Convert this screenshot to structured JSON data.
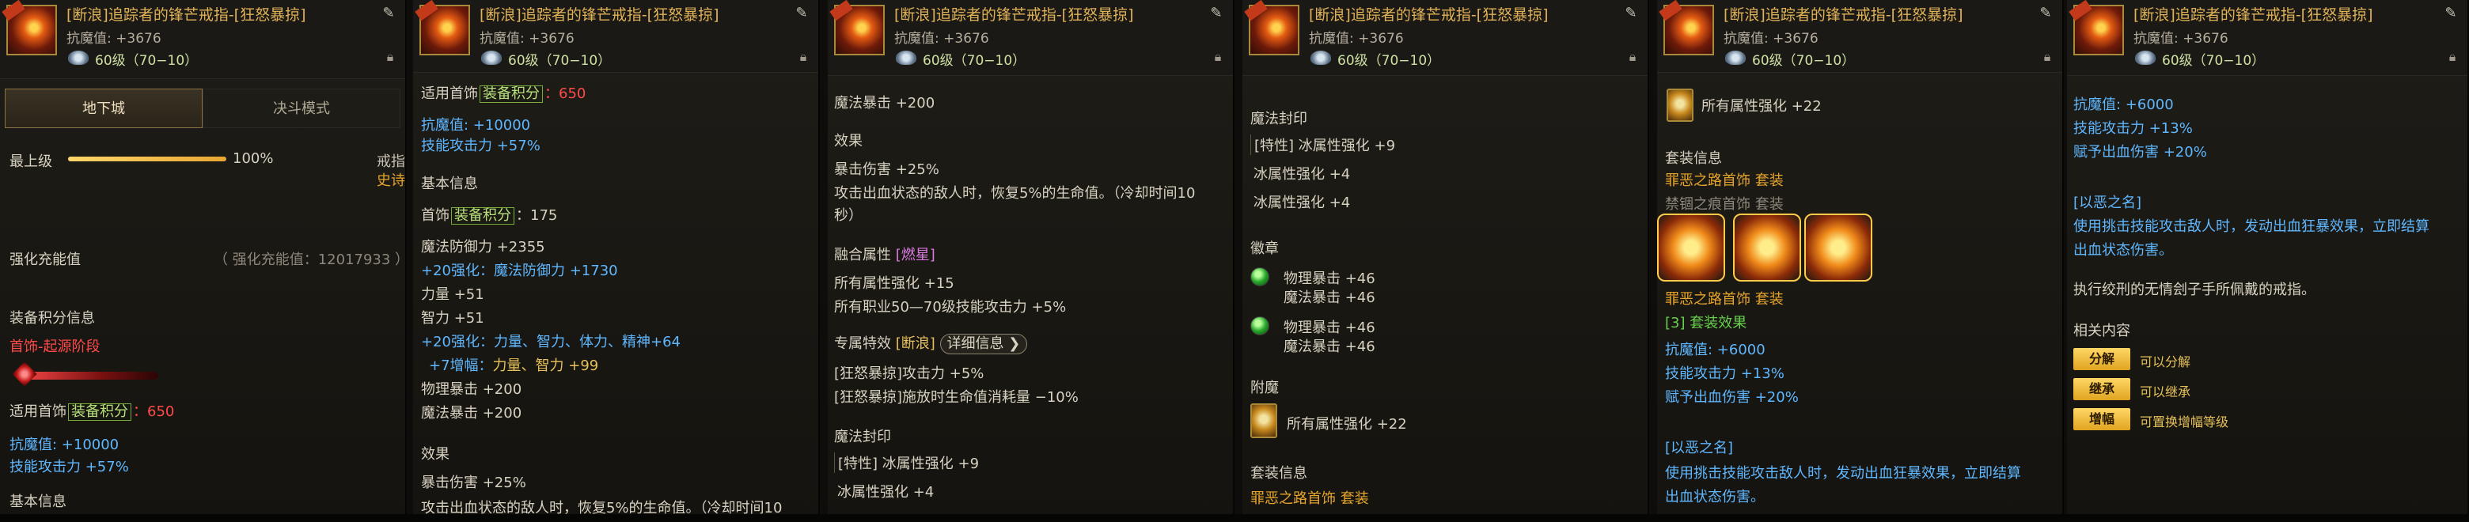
{
  "item": {
    "title": "[断浪]追踪者的锋芒戒指-[狂怒暴掠]",
    "resist": "抗魔值: +3676",
    "level": "60级（70−10）"
  },
  "p1": {
    "tab_dungeon": "地下城",
    "tab_duel": "决斗模式",
    "top_level": "最上级",
    "percent": "100%",
    "progress": 1.0,
    "type": "戒指",
    "rarity": "史诗",
    "reinforce_label": "强化充能值",
    "reinforce_value": "（ 强化充能值：12017933 ）",
    "score_info": "装备积分信息",
    "stage": "首饰-起源阶段",
    "apply_prefix": "适用首饰",
    "apply_kw": "装备积分",
    "apply_suffix": "：650",
    "resist_bonus": "抗魔值: +10000",
    "skill_bonus": "技能攻击力 +57%",
    "basic": "基本信息"
  },
  "p2": {
    "apply_prefix": "适用首饰",
    "apply_kw": "装备积分",
    "apply_val": "：650",
    "resist_bonus": "抗魔值: +10000",
    "skill_bonus": "技能攻击力 +57%",
    "basic": "基本信息",
    "acc_prefix": "首饰",
    "acc_kw": "装备积分",
    "acc_val": "：175",
    "mdef": "魔法防御力 +2355",
    "reinforce_prefix": "+20强化：",
    "reinforce_val": "魔法防御力 +1730",
    "str": "力量 +51",
    "int": "智力 +51",
    "r20_prefix": "+20强化：",
    "r20_val": "力量、智力、体力、精神+64",
    "amp_prefix": "+7增幅：",
    "amp_val": "力量、智力 +99",
    "phys_crit": "物理暴击 +200",
    "mag_crit": "魔法暴击 +200",
    "effect": "效果",
    "crit_dmg": "暴击伤害 +25%",
    "cut_line": "攻击出血状态的敌人时，恢复5%的生命值。（冷却时间10"
  },
  "p3": {
    "mag_crit": "魔法暴击 +200",
    "effect": "效果",
    "crit_dmg": "暴击伤害 +25%",
    "heal1": "攻击出血状态的敌人时，恢复5%的生命值。（冷却时间10",
    "heal2": "秒）",
    "fusion_prefix": "融合属性",
    "fusion_tag": "[燃星]",
    "all_elem": "所有属性强化 +15",
    "all_job": "所有职业50—70级技能攻击力 +5%",
    "special_prefix": "专属特效",
    "special_tag": "[断浪]",
    "detail": "详细信息",
    "special1": "[狂怒暴掠]攻击力 +5%",
    "special2": "[狂怒暴掠]施放时生命值消耗量 −10%",
    "seal": "魔法封印",
    "seal_trait": "[特性] 冰属性强化 +9",
    "seal_ice": "冰属性强化 +4"
  },
  "p4": {
    "seal": "魔法封印",
    "seal_trait": "[特性] 冰属性强化 +9",
    "ice1": "冰属性强化 +4",
    "ice2": "冰属性强化 +4",
    "emblem": "徽章",
    "em1a": "物理暴击 +46",
    "em1b": "魔法暴击 +46",
    "em2a": "物理暴击 +46",
    "em2b": "魔法暴击 +46",
    "enchant": "附魔",
    "enchant_val": "所有属性强化 +22",
    "set_info": "套装信息",
    "set_line_prefix": "罪恶之路首饰",
    "set_line_suffix": "套装"
  },
  "p5": {
    "enchant_val": "所有属性强化 +22",
    "set_info": "套装信息",
    "set1_prefix": "罪恶之路首饰",
    "set1_suffix": "套装",
    "set2_prefix": "禁锢之痕首饰",
    "set2_suffix": "套装",
    "set3_prefix": "罪恶之路首饰",
    "set3_suffix": "套装",
    "set_effect": "[3] 套装效果",
    "resist": "抗魔值: +6000",
    "skill": "技能攻击力 +13%",
    "bleed": "赋予出血伤害 +20%",
    "evil_name": "[以恶之名]",
    "evil1": "使用挑击技能攻击敌人时，发动出血狂暴效果，立即结算",
    "evil2": "出血状态伤害。"
  },
  "p6": {
    "set_effect_cut": "[3] 套装效果",
    "resist": "抗魔值: +6000",
    "skill": "技能攻击力 +13%",
    "bleed": "赋予出血伤害 +20%",
    "evil_name": "[以恶之名]",
    "evil1": "使用挑击技能攻击敌人时，发动出血狂暴效果，立即结算",
    "evil2": "出血状态伤害。",
    "flavor": "执行绞刑的无情刽子手所佩戴的戒指。",
    "related": "相关内容",
    "btn_split": "分解",
    "split_ok": "可以分解",
    "btn_inherit": "继承",
    "inherit_ok": "可以继承",
    "btn_amp": "增幅",
    "amp_ok": "可置换增幅等级"
  },
  "icons": [
    "edit-icon",
    "lock-icon",
    "level-gem-icon",
    "emblem-gem-icon",
    "enchant-card-icon",
    "detail-chevron-icon"
  ],
  "colors": {
    "title": "#e0b257",
    "blue": "#5fb7ff",
    "red": "#ff4a4a",
    "orange": "#e5a42c",
    "green": "#67d04e",
    "gold_button": "#e6b030"
  }
}
